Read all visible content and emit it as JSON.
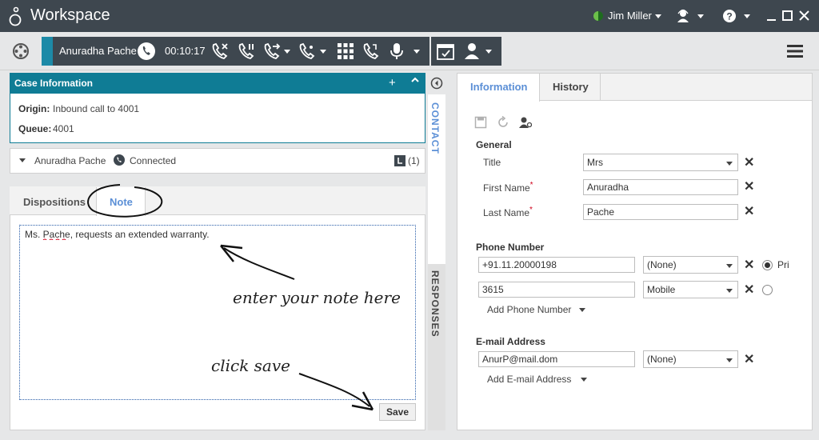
{
  "app": {
    "title": "Workspace"
  },
  "user": {
    "name": "Jim Miller"
  },
  "call": {
    "caller_name": "Anuradha Pache",
    "timer": "00:10:17"
  },
  "case": {
    "title": "Case Information",
    "origin_label": "Origin:",
    "origin_value": "Inbound call to 4001",
    "queue_label": "Queue:",
    "queue_value": "4001"
  },
  "party": {
    "name": "Anuradha Pache",
    "status": "Connected",
    "count": "(1)"
  },
  "tabs": {
    "dispositions": "Dispositions",
    "note": "Note"
  },
  "note": {
    "text": "Ms. Pache, requests an extended warranty.",
    "save_label": "Save"
  },
  "annotations": {
    "enter_note": "enter your note here",
    "click_save": "click save"
  },
  "side_tabs": {
    "contact": "CONTACT",
    "responses": "RESPONSES"
  },
  "contact": {
    "tabs": {
      "information": "Information",
      "history": "History"
    },
    "general_label": "General",
    "title_label": "Title",
    "title_value": "Mrs",
    "first_name_label": "First Name",
    "first_name_value": "Anuradha",
    "last_name_label": "Last Name",
    "last_name_value": "Pache",
    "required_mark": "*",
    "phone_section": "Phone Number",
    "phones": [
      {
        "number": "+91.11.20000198",
        "type": "(None)",
        "primary_label": "Pri"
      },
      {
        "number": "3615",
        "type": "Mobile"
      }
    ],
    "add_phone": "Add Phone Number",
    "email_section": "E-mail Address",
    "emails": [
      {
        "address": "AnurP@mail.dom",
        "type": "(None)"
      }
    ],
    "add_email": "Add E-mail Address"
  },
  "colors": {
    "accent": "#0f7c95",
    "link": "#5b8fd6",
    "dark": "#3e474f"
  }
}
